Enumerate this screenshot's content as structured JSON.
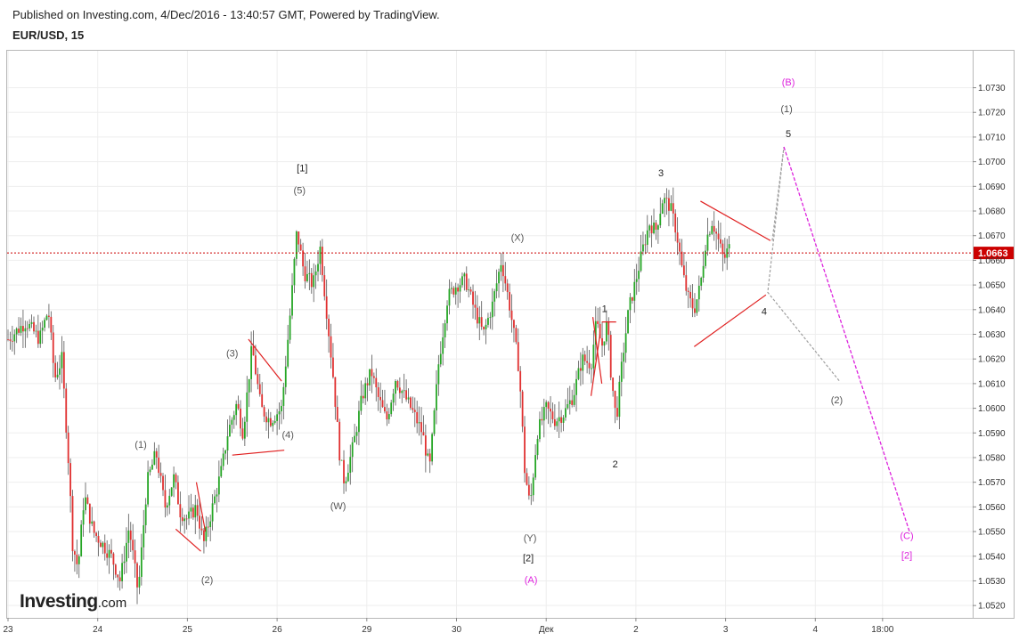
{
  "header": {
    "published": "Published on Investing.com, 4/Dec/2016 - 13:40:57 GMT, Powered by TradingView.",
    "symbol": "EUR/USD, 15"
  },
  "logo": {
    "text": "Investing",
    "suffix": ".com"
  },
  "chart_data": {
    "type": "candlestick",
    "symbol": "EUR/USD, 15",
    "ylim": [
      1.0515,
      1.0745
    ],
    "y_ticks": [
      1.052,
      1.053,
      1.054,
      1.055,
      1.056,
      1.057,
      1.058,
      1.059,
      1.06,
      1.061,
      1.062,
      1.063,
      1.064,
      1.065,
      1.066,
      1.067,
      1.068,
      1.069,
      1.07,
      1.071,
      1.072,
      1.073
    ],
    "y_tick_labels": [
      "1.0520",
      "1.0530",
      "1.0540",
      "1.0550",
      "1.0560",
      "1.0570",
      "1.0580",
      "1.0590",
      "1.0600",
      "1.0610",
      "1.0620",
      "1.0630",
      "1.0640",
      "1.0650",
      "1.0660",
      "1.0670",
      "1.0680",
      "1.0690",
      "1.0700",
      "1.0710",
      "1.0720",
      "1.0730"
    ],
    "x_ticks": [
      {
        "label": "23",
        "t": 0
      },
      {
        "label": "24",
        "t": 1
      },
      {
        "label": "25",
        "t": 2
      },
      {
        "label": "26",
        "t": 3
      },
      {
        "label": "29",
        "t": 4
      },
      {
        "label": "30",
        "t": 5
      },
      {
        "label": "Дек",
        "t": 6
      },
      {
        "label": "2",
        "t": 7
      },
      {
        "label": "3",
        "t": 8
      },
      {
        "label": "4",
        "t": 9
      },
      {
        "label": "18:00",
        "t": 9.75
      }
    ],
    "last_price": 1.0663,
    "last_price_label": "1.0663",
    "grid": true,
    "colors": {
      "up": "#26a626",
      "down": "#e03030",
      "wick": "#555555",
      "wave": "#e02020",
      "projection_gray": "#a0a0a0",
      "projection_magenta": "#dd22dd",
      "price_line": "#cc0000"
    },
    "series_path": [
      [
        0,
        1.0628
      ],
      [
        0.2,
        1.0635
      ],
      [
        0.35,
        1.0628
      ],
      [
        0.45,
        1.064
      ],
      [
        0.52,
        1.0612
      ],
      [
        0.6,
        1.062
      ],
      [
        0.68,
        1.0575
      ],
      [
        0.72,
        1.0545
      ],
      [
        0.78,
        1.0535
      ],
      [
        0.85,
        1.0565
      ],
      [
        0.95,
        1.055
      ],
      [
        1.05,
        1.0545
      ],
      [
        1.15,
        1.054
      ],
      [
        1.25,
        1.053
      ],
      [
        1.35,
        1.0552
      ],
      [
        1.45,
        1.0525
      ],
      [
        1.55,
        1.057
      ],
      [
        1.65,
        1.0582
      ],
      [
        1.75,
        1.056
      ],
      [
        1.85,
        1.0572
      ],
      [
        1.92,
        1.0558
      ],
      [
        2.0,
        1.0555
      ],
      [
        2.1,
        1.056
      ],
      [
        2.18,
        1.0545
      ],
      [
        2.28,
        1.056
      ],
      [
        2.38,
        1.0575
      ],
      [
        2.45,
        1.059
      ],
      [
        2.55,
        1.0602
      ],
      [
        2.62,
        1.059
      ],
      [
        2.72,
        1.0625
      ],
      [
        2.82,
        1.06
      ],
      [
        2.92,
        1.0595
      ],
      [
        3.05,
        1.06
      ],
      [
        3.15,
        1.064
      ],
      [
        3.22,
        1.0672
      ],
      [
        3.3,
        1.0655
      ],
      [
        3.4,
        1.065
      ],
      [
        3.48,
        1.0665
      ],
      [
        3.55,
        1.064
      ],
      [
        3.62,
        1.0615
      ],
      [
        3.7,
        1.058
      ],
      [
        3.75,
        1.057
      ],
      [
        3.85,
        1.0585
      ],
      [
        3.95,
        1.0605
      ],
      [
        4.05,
        1.0615
      ],
      [
        4.12,
        1.0605
      ],
      [
        4.22,
        1.0595
      ],
      [
        4.32,
        1.0612
      ],
      [
        4.42,
        1.0605
      ],
      [
        4.52,
        1.0598
      ],
      [
        4.62,
        1.059
      ],
      [
        4.7,
        1.0575
      ],
      [
        4.8,
        1.0618
      ],
      [
        4.9,
        1.0645
      ],
      [
        5.0,
        1.065
      ],
      [
        5.1,
        1.0652
      ],
      [
        5.2,
        1.064
      ],
      [
        5.3,
        1.063
      ],
      [
        5.4,
        1.0642
      ],
      [
        5.5,
        1.066
      ],
      [
        5.6,
        1.064
      ],
      [
        5.7,
        1.0615
      ],
      [
        5.76,
        1.0575
      ],
      [
        5.82,
        1.056
      ],
      [
        5.9,
        1.059
      ],
      [
        6.0,
        1.06
      ],
      [
        6.1,
        1.0595
      ],
      [
        6.2,
        1.0598
      ],
      [
        6.3,
        1.0605
      ],
      [
        6.4,
        1.062
      ],
      [
        6.5,
        1.0618
      ],
      [
        6.56,
        1.0635
      ],
      [
        6.62,
        1.0625
      ],
      [
        6.68,
        1.0635
      ],
      [
        6.72,
        1.0615
      ],
      [
        6.78,
        1.0595
      ],
      [
        6.85,
        1.062
      ],
      [
        6.92,
        1.064
      ],
      [
        7.0,
        1.0652
      ],
      [
        7.08,
        1.0665
      ],
      [
        7.15,
        1.0675
      ],
      [
        7.22,
        1.0672
      ],
      [
        7.3,
        1.0685
      ],
      [
        7.38,
        1.0682
      ],
      [
        7.45,
        1.0672
      ],
      [
        7.52,
        1.0655
      ],
      [
        7.58,
        1.0645
      ],
      [
        7.65,
        1.064
      ],
      [
        7.72,
        1.065
      ],
      [
        7.78,
        1.0668
      ],
      [
        7.85,
        1.0676
      ],
      [
        7.92,
        1.0668
      ],
      [
        7.98,
        1.066
      ],
      [
        8.03,
        1.0665
      ]
    ],
    "last_index_t": 8.05,
    "wave_lines": [
      {
        "x1": 1.87,
        "y1": 1.0551,
        "x2": 2.15,
        "y2": 1.0542
      },
      {
        "x1": 2.1,
        "y1": 1.057,
        "x2": 2.2,
        "y2": 1.055
      },
      {
        "x1": 2.5,
        "y1": 1.0581,
        "x2": 3.08,
        "y2": 1.0583
      },
      {
        "x1": 2.68,
        "y1": 1.0628,
        "x2": 3.05,
        "y2": 1.0611
      },
      {
        "x1": 6.52,
        "y1": 1.0637,
        "x2": 6.62,
        "y2": 1.061
      },
      {
        "x1": 6.6,
        "y1": 1.063,
        "x2": 6.5,
        "y2": 1.0605
      },
      {
        "x1": 6.62,
        "y1": 1.0635,
        "x2": 6.78,
        "y2": 1.0635
      },
      {
        "x1": 7.72,
        "y1": 1.0684,
        "x2": 8.5,
        "y2": 1.0668
      },
      {
        "x1": 7.65,
        "y1": 1.0625,
        "x2": 8.45,
        "y2": 1.0646
      }
    ],
    "projection_gray": [
      [
        8.52,
        1.0668
      ],
      [
        8.65,
        1.0706
      ],
      [
        8.47,
        1.0647
      ],
      [
        9.27,
        1.0611
      ]
    ],
    "projection_magenta": [
      [
        8.65,
        1.0706
      ],
      [
        10.05,
        1.055
      ]
    ],
    "annotations": [
      {
        "text": "[1]",
        "t": 3.28,
        "y": 1.0696,
        "color": "#222222"
      },
      {
        "text": "(5)",
        "t": 3.25,
        "y": 1.0687,
        "color": "#555555"
      },
      {
        "text": "(1)",
        "t": 1.48,
        "y": 1.0584,
        "color": "#555555"
      },
      {
        "text": "(2)",
        "t": 2.22,
        "y": 1.0529,
        "color": "#555555"
      },
      {
        "text": "(3)",
        "t": 2.5,
        "y": 1.0621,
        "color": "#555555"
      },
      {
        "text": "(4)",
        "t": 3.12,
        "y": 1.0588,
        "color": "#555555"
      },
      {
        "text": "(W)",
        "t": 3.68,
        "y": 1.0559,
        "color": "#555555"
      },
      {
        "text": "(X)",
        "t": 5.68,
        "y": 1.0668,
        "color": "#555555"
      },
      {
        "text": "(Y)",
        "t": 5.82,
        "y": 1.0546,
        "color": "#555555"
      },
      {
        "text": "[2]",
        "t": 5.8,
        "y": 1.0538,
        "color": "#222222"
      },
      {
        "text": "(A)",
        "t": 5.83,
        "y": 1.0529,
        "color": "#dd22dd"
      },
      {
        "text": "1",
        "t": 6.65,
        "y": 1.0639,
        "color": "#222222"
      },
      {
        "text": "2",
        "t": 6.77,
        "y": 1.0576,
        "color": "#222222"
      },
      {
        "text": "3",
        "t": 7.28,
        "y": 1.0694,
        "color": "#222222"
      },
      {
        "text": "4",
        "t": 8.43,
        "y": 1.0638,
        "color": "#222222"
      },
      {
        "text": "5",
        "t": 8.7,
        "y": 1.071,
        "color": "#222222"
      },
      {
        "text": "(1)",
        "t": 8.68,
        "y": 1.072,
        "color": "#555555"
      },
      {
        "text": "(B)",
        "t": 8.7,
        "y": 1.0731,
        "color": "#dd22dd"
      },
      {
        "text": "(2)",
        "t": 9.24,
        "y": 1.0602,
        "color": "#555555"
      },
      {
        "text": "(C)",
        "t": 10.02,
        "y": 1.0547,
        "color": "#dd22dd"
      },
      {
        "text": "[2]",
        "t": 10.02,
        "y": 1.0539,
        "color": "#dd22dd"
      }
    ]
  }
}
